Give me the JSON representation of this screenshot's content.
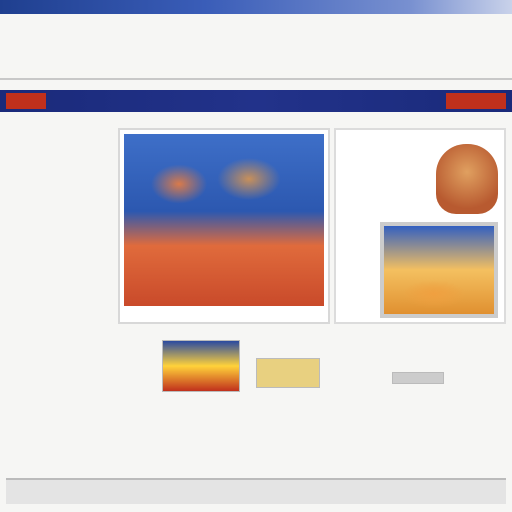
{
  "window": {
    "title_strip": ""
  },
  "intro": {
    "lines": [
      "",
      "",
      ""
    ]
  },
  "nav": {
    "logo": "",
    "items": [],
    "logo_right": ""
  },
  "sidebar": {
    "blocks": []
  },
  "feature": {
    "caption": ""
  },
  "promo": {
    "title": ""
  },
  "thumbs": {
    "thumb2": "",
    "thumb3": ""
  },
  "body": {
    "lines": []
  },
  "footer": {
    "text": ""
  },
  "colors": {
    "nav_bg": "#1a2a7a",
    "accent_red": "#c0301c",
    "accent_orange": "#ff8a3a"
  }
}
